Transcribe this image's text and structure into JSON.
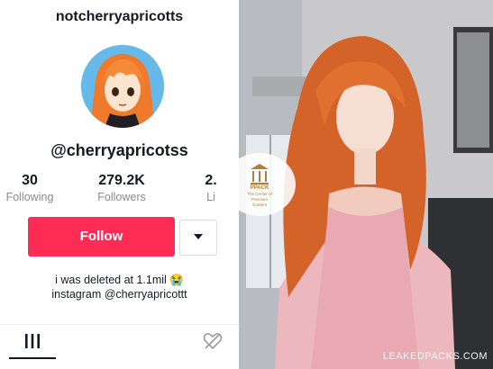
{
  "profile": {
    "top_username": "notcherryapricotts",
    "handle": "@cherryapricotss",
    "stats": [
      {
        "value": "30",
        "label": "Following"
      },
      {
        "value": "279.2K",
        "label": "Followers"
      },
      {
        "value": "2.",
        "label": "Li"
      }
    ],
    "follow_label": "Follow",
    "bio_line1": "i was deleted at 1.1mil 😭",
    "bio_line2": "instagram @cherryapricottt"
  },
  "tabs": {
    "videos_icon": "grid-bars-icon",
    "liked_icon": "hidden-heart-icon"
  },
  "overlay": {
    "badge_title": "PPACK",
    "badge_sub1": "The Center of",
    "badge_sub2": "Premium",
    "badge_sub3": "Content",
    "watermark": "LEAKEDPACKS.COM"
  },
  "colors": {
    "follow": "#fe2c55",
    "text": "#161823",
    "muted": "#8a8b91"
  }
}
